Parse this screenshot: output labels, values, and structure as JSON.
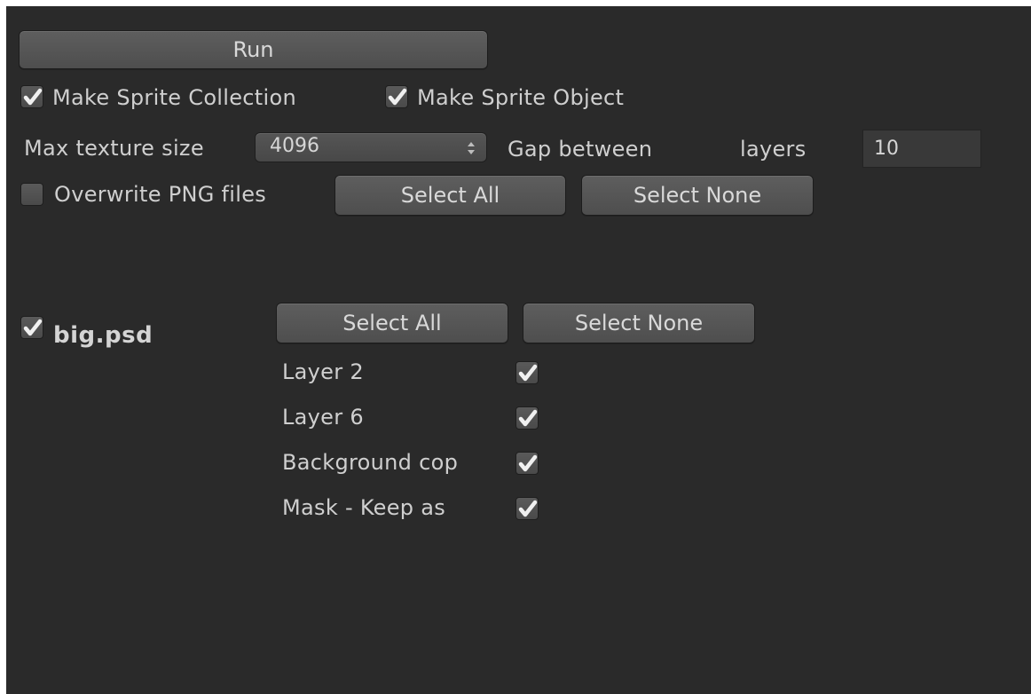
{
  "toolbar": {
    "run_label": "Run"
  },
  "options": {
    "make_sprite_collection": {
      "label": "Make Sprite Collection",
      "checked": true
    },
    "make_sprite_object": {
      "label": "Make Sprite Object",
      "checked": true
    },
    "max_texture_size": {
      "label": "Max texture size",
      "value": "4096"
    },
    "gap_between_layers": {
      "label_1": "Gap between",
      "label_2": "layers",
      "value": "10"
    },
    "overwrite_png": {
      "label": "Overwrite PNG files",
      "checked": false
    },
    "select_all_label": "Select All",
    "select_none_label": "Select None"
  },
  "file": {
    "name": "big.psd",
    "checked": true,
    "select_all_label": "Select All",
    "select_none_label": "Select None",
    "layers": [
      {
        "label": "Layer 2",
        "checked": true
      },
      {
        "label": "Layer 6",
        "checked": true
      },
      {
        "label": "Background cop",
        "checked": true
      },
      {
        "label": "Mask - Keep as",
        "checked": true
      }
    ]
  },
  "colors": {
    "background": "#2a2a2a",
    "text": "#cfcfcf",
    "button": "#565656"
  },
  "icons": {
    "checkmark": "check-icon",
    "dropdown_arrows": "updown-arrows-icon"
  }
}
